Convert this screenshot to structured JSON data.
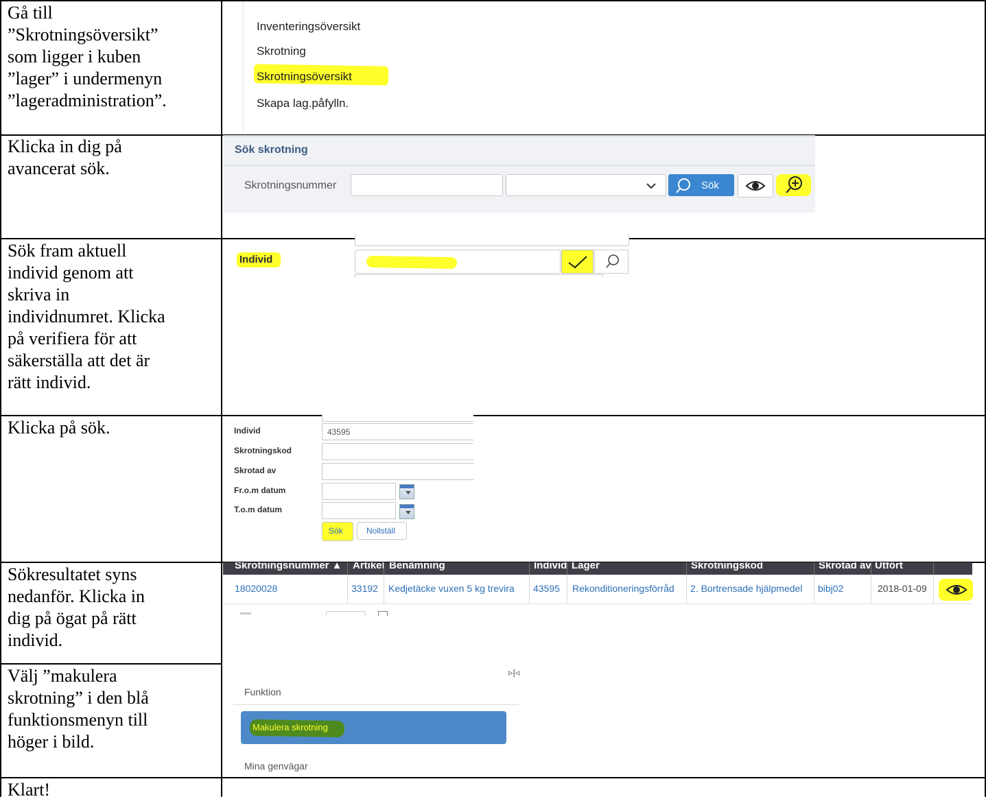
{
  "instructions": [
    "Gå till\n”Skrotningsöversikt”\nsom ligger i kuben\n”lager” i undermenyn\n”lageradministration”.",
    "Klicka in dig på\navancerat sök.",
    "Sök fram aktuell\nindivid genom att\nskriva in\nindividnumret. Klicka\npå verifiera för att\nsäkerställa att det är\nrätt individ.",
    "Klicka på sök.",
    "Sökresultatet syns\nnedanför. Klicka in\ndig på ögat på rätt\nindivid.",
    "Välj ”makulera\nskrotning” i den blå\nfunktionsmenyn till\nhöger i bild.",
    "Klart!"
  ],
  "menu": {
    "items": [
      "Inventeringsöversikt",
      "Skrotning",
      "Skrotningsöversikt",
      "Skapa lag.påfylln."
    ]
  },
  "search_panel": {
    "title": "Sök skrotning",
    "field_label": "Skrotningsnummer",
    "search_button": "Sök"
  },
  "individ_row": {
    "label": "Individ"
  },
  "adv_form": {
    "fields": [
      {
        "label": "Individ",
        "value": "43595"
      },
      {
        "label": "Skrotningskod",
        "value": ""
      },
      {
        "label": "Skrotad av",
        "value": ""
      },
      {
        "label": "Fr.o.m datum",
        "value": ""
      },
      {
        "label": "T.o.m datum",
        "value": ""
      }
    ],
    "search_button": "Sök",
    "reset_button": "Nollställ"
  },
  "results": {
    "headers": [
      "Skrotningsnummer ▲",
      "Artikel",
      "Benämning",
      "Individ",
      "Lager",
      "Skrotningskod",
      "Skrotad av",
      "Utfört"
    ],
    "row": [
      "18020028",
      "33192",
      "Kedjetäcke vuxen 5 kg trevira",
      "43595",
      "Rekonditioneringsförråd",
      "2. Bortrensade hjälpmedel",
      "bibj02",
      "2018-01-09"
    ]
  },
  "function_menu": {
    "heading": "Funktion",
    "action": "Makulera skrotning",
    "shortcuts": "Mina genvägar"
  },
  "colors": {
    "highlight": "#ffff2b",
    "primary_blue": "#3a86d0",
    "function_blue": "#4d89c9",
    "header_dark": "#3e3f47"
  }
}
